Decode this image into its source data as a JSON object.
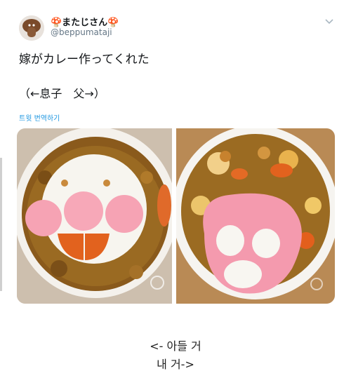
{
  "tweet": {
    "display_name": "🍄またじさん🍄",
    "handle": "@beppumataji",
    "text_line1": "嫁がカレー作ってくれた",
    "text_line2": "（←息子　父→）",
    "translate_link": "트윗 번역하기"
  },
  "captions": {
    "line1": "<- 아들 거",
    "line2": "내 거->"
  },
  "icons": {
    "avatar": "mushroom-avatar",
    "menu": "chevron-down-icon"
  }
}
